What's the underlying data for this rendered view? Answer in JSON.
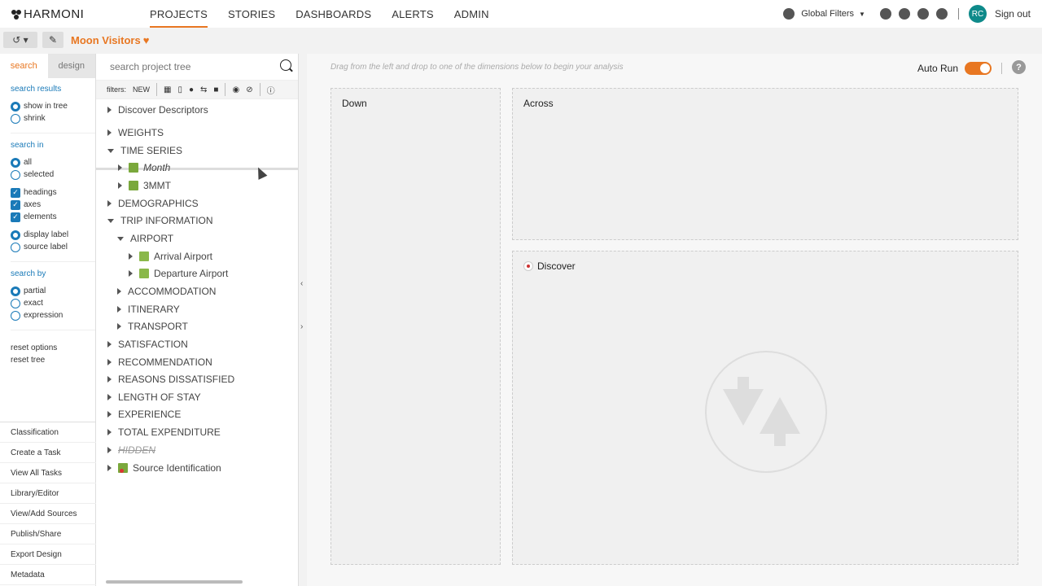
{
  "app": {
    "name": "HARMONI"
  },
  "nav": {
    "items": [
      "PROJECTS",
      "STORIES",
      "DASHBOARDS",
      "ALERTS",
      "ADMIN"
    ],
    "active": "PROJECTS"
  },
  "topright": {
    "global_filters": "Global Filters",
    "avatar_initials": "RC",
    "sign_out": "Sign out"
  },
  "project": {
    "title": "Moon Visitors"
  },
  "left_tabs": {
    "search": "search",
    "design": "design"
  },
  "search_options": {
    "results_head": "search results",
    "results": [
      "show in tree",
      "shrink"
    ],
    "in_head": "search in",
    "in": [
      "all",
      "selected"
    ],
    "checks": [
      "headings",
      "axes",
      "elements"
    ],
    "labels": [
      "display label",
      "source label"
    ],
    "by_head": "search by",
    "by": [
      "partial",
      "exact",
      "expression"
    ],
    "reset_options": "reset options",
    "reset_tree": "reset tree"
  },
  "bottom_links": [
    "Classification",
    "Create a Task",
    "View All Tasks",
    "Library/Editor",
    "View/Add Sources",
    "Publish/Share",
    "Export Design",
    "Metadata"
  ],
  "tree": {
    "search_placeholder": "search project tree",
    "filters_label": "filters:",
    "filters_new": "NEW",
    "nodes": [
      {
        "label": "Discover Descriptors"
      },
      {
        "label": "WEIGHTS"
      },
      {
        "label": "TIME SERIES"
      },
      {
        "label": "Month"
      },
      {
        "label": "3MMT"
      },
      {
        "label": "DEMOGRAPHICS"
      },
      {
        "label": "TRIP INFORMATION"
      },
      {
        "label": "AIRPORT"
      },
      {
        "label": "Arrival Airport"
      },
      {
        "label": "Departure Airport"
      },
      {
        "label": "ACCOMMODATION"
      },
      {
        "label": "ITINERARY"
      },
      {
        "label": "TRANSPORT"
      },
      {
        "label": "SATISFACTION"
      },
      {
        "label": "RECOMMENDATION"
      },
      {
        "label": "REASONS DISSATISFIED"
      },
      {
        "label": "LENGTH OF STAY"
      },
      {
        "label": "EXPERIENCE"
      },
      {
        "label": "TOTAL EXPENDITURE"
      },
      {
        "label": "HIDDEN"
      },
      {
        "label": "Source Identification"
      }
    ]
  },
  "main": {
    "hint": "Drag from the left and drop to one of the dimensions below to begin your analysis",
    "auto_run": "Auto Run",
    "down": "Down",
    "across": "Across",
    "discover": "Discover"
  },
  "colors": {
    "accent": "#e87722",
    "link": "#1a7ab8",
    "avatar": "#0e8a8a"
  }
}
